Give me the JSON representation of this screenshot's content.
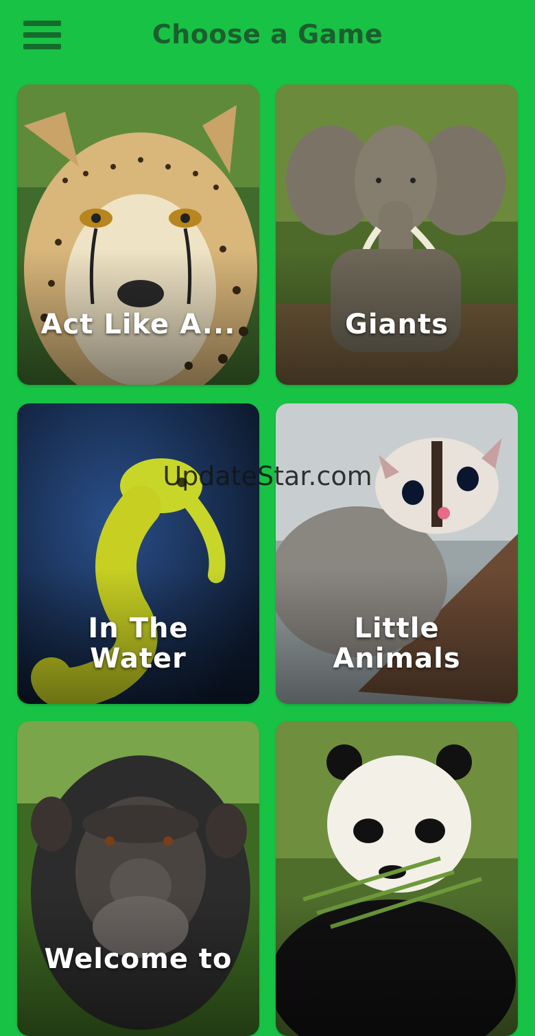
{
  "header": {
    "title": "Choose a Game",
    "menu_icon": "hamburger-menu-icon"
  },
  "games": [
    {
      "label": "Act Like A...",
      "animal": "cheetah"
    },
    {
      "label": "Giants",
      "animal": "elephant"
    },
    {
      "label": "In The\nWater",
      "animal": "seahorse"
    },
    {
      "label": "Little\nAnimals",
      "animal": "sugar-glider"
    },
    {
      "label": "Welcome to",
      "animal": "chimpanzee"
    },
    {
      "label": "",
      "animal": "panda"
    }
  ],
  "watermark": "UpdateStar.com",
  "colors": {
    "background": "#18c244",
    "header_text": "#1b5e2f",
    "card_text": "#ffffff"
  }
}
